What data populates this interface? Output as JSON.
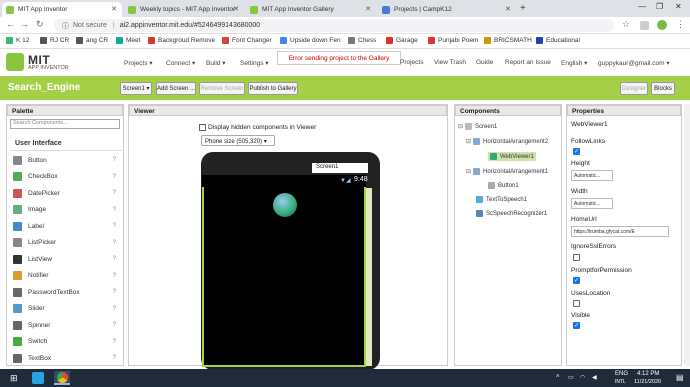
{
  "tabs": [
    {
      "title": "MIT App Inventor",
      "color": "#8ac53f"
    },
    {
      "title": "Weekly topics - MIT App Inventor",
      "color": "#8ac53f"
    },
    {
      "title": "MIT App Inventor Gallery",
      "color": "#8ac53f"
    },
    {
      "title": "Projects | CampK12",
      "color": "#4a7bd0"
    }
  ],
  "address": {
    "security": "Not secure",
    "url": "ai2.appinventor.mit.edu/#5246499143680000"
  },
  "bookmarks": [
    {
      "label": "K 12",
      "color": "#3b7"
    },
    {
      "label": "RJ CR",
      "color": "#555"
    },
    {
      "label": "ang CR",
      "color": "#555"
    },
    {
      "label": "Meet",
      "color": "#1a9"
    },
    {
      "label": "Backgroud Remove",
      "color": "#d33"
    },
    {
      "label": "Font Changer",
      "color": "#c44"
    },
    {
      "label": "Upside down Fen",
      "color": "#4285f4"
    },
    {
      "label": "Chess",
      "color": "#777"
    },
    {
      "label": "Garage",
      "color": "#d33"
    },
    {
      "label": "Punjabi Poem",
      "color": "#d33"
    },
    {
      "label": "BRICSMATH",
      "color": "#c90"
    },
    {
      "label": "Educational",
      "color": "#24a"
    }
  ],
  "app": {
    "logo_text": "MIT",
    "logo_sub": "APP INVENTOR",
    "menus": [
      "Projects ▾",
      "Connect ▾",
      "Build ▾",
      "Settings ▾"
    ],
    "right_menus": [
      "Projects",
      "View Trash",
      "Guide",
      "Report an Issue",
      "English ▾",
      "guppykaur@gmail.com ▾"
    ],
    "error": "Error sending project to the Gallery"
  },
  "toolbar": {
    "project": "Search_Engine",
    "screen_select": "Screen1 ▾",
    "add_screen": "Add Screen ...",
    "remove_screen": "Remove Screen",
    "publish": "Publish to Gallery",
    "designer": "Designer",
    "blocks": "Blocks"
  },
  "palette": {
    "title": "Palette",
    "search_placeholder": "Search Components...",
    "group": "User Interface",
    "items": [
      {
        "label": "Button",
        "icon": "button-icon",
        "color": "#888"
      },
      {
        "label": "CheckBox",
        "icon": "checkbox-icon",
        "color": "#5a5"
      },
      {
        "label": "DatePicker",
        "icon": "datepicker-icon",
        "color": "#c55"
      },
      {
        "label": "Image",
        "icon": "image-icon",
        "color": "#6a8"
      },
      {
        "label": "Label",
        "icon": "label-icon",
        "color": "#48c"
      },
      {
        "label": "ListPicker",
        "icon": "listpicker-icon",
        "color": "#888"
      },
      {
        "label": "ListView",
        "icon": "listview-icon",
        "color": "#333"
      },
      {
        "label": "Notifier",
        "icon": "notifier-icon",
        "color": "#d93"
      },
      {
        "label": "PasswordTextBox",
        "icon": "password-icon",
        "color": "#666"
      },
      {
        "label": "Slider",
        "icon": "slider-icon",
        "color": "#59c"
      },
      {
        "label": "Spinner",
        "icon": "spinner-icon",
        "color": "#666"
      },
      {
        "label": "Switch",
        "icon": "switch-icon",
        "color": "#4a4"
      },
      {
        "label": "TextBox",
        "icon": "textbox-icon",
        "color": "#666"
      }
    ],
    "help": "?"
  },
  "viewer": {
    "title": "Viewer",
    "hidden_label": "Display hidden components in Viewer",
    "phone_size": "Phone size (505,320) ▾",
    "screen_tab": "Screen1",
    "clock": "9:48"
  },
  "components": {
    "title": "Components",
    "tree": [
      {
        "label": "Screen1",
        "icon": "screen-icon"
      },
      {
        "label": "HorizontalArrangement2",
        "icon": "arrangement-icon"
      },
      {
        "label": "WebViewer1",
        "icon": "webviewer-icon"
      },
      {
        "label": "HorizontalArrangement1",
        "icon": "arrangement-icon"
      },
      {
        "label": "Button1",
        "icon": "button-icon"
      },
      {
        "label": "TextToSpeech1",
        "icon": "texttospeech-icon"
      },
      {
        "label": "ScSpeechRecognizer1",
        "icon": "speech-icon"
      }
    ]
  },
  "properties": {
    "title": "Properties",
    "component": "WebViewer1",
    "follow_links": "FollowLinks",
    "height": "Height",
    "height_val": "Automatic...",
    "width": "Width",
    "width_val": "Automatic...",
    "home_url": "HomeUrl",
    "home_url_val": "https://trumba.gfycat.com/E",
    "ignore_ssl": "IgnoreSslErrors",
    "prompt": "PromptforPermission",
    "uses_location": "UsesLocation",
    "visible": "Visible"
  },
  "taskbar": {
    "lang": "ENG",
    "lang2": "INTL",
    "time": "4:12 PM",
    "date": "11/21/2020"
  }
}
